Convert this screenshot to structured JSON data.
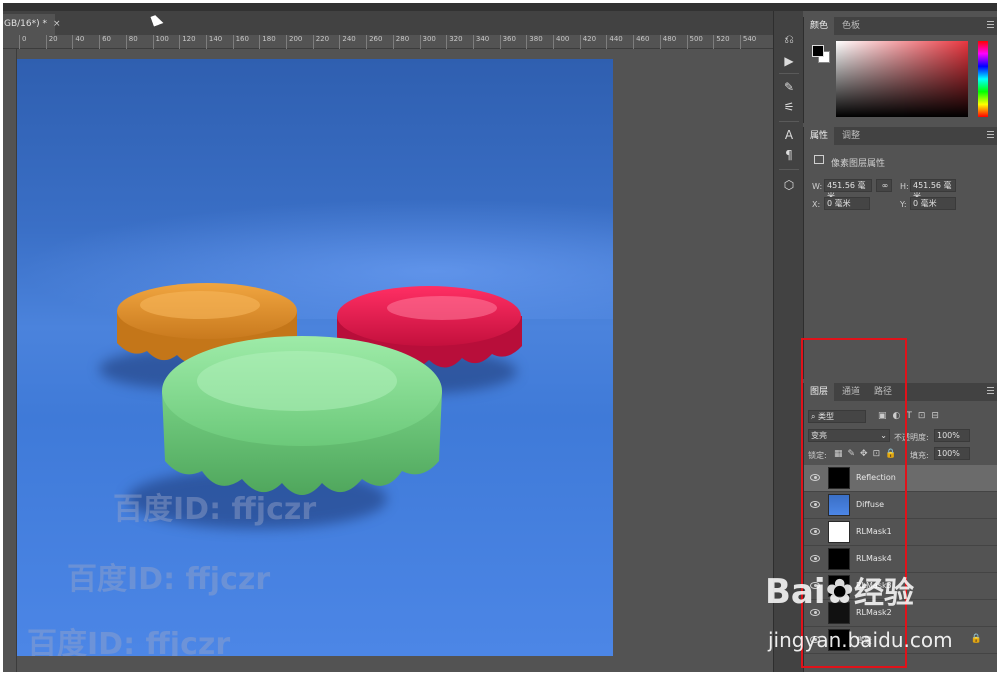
{
  "document_tab": {
    "title": "GB/16*) *",
    "close": "×"
  },
  "ruler_ticks": [
    "0",
    "20",
    "40",
    "60",
    "80",
    "100",
    "120",
    "140",
    "160",
    "180",
    "200",
    "220",
    "240",
    "260",
    "280",
    "300",
    "320",
    "340",
    "360",
    "380",
    "400",
    "420",
    "440",
    "460",
    "480",
    "500",
    "520",
    "540"
  ],
  "canvas_watermarks": [
    "百度ID: ffjczr",
    "百度ID: ffjczr",
    "百度ID: ffjczr"
  ],
  "color_panel": {
    "tabs": [
      "颜色",
      "色板"
    ],
    "foreground": "#000000",
    "background": "#ffffff",
    "hue_color": "#e8363f"
  },
  "properties_panel": {
    "tabs": [
      "属性",
      "调整"
    ],
    "title": "像素图层属性",
    "w_label": "W:",
    "w_value": "451.56 毫米",
    "h_label": "H:",
    "h_value": "451.56 毫米",
    "x_label": "X:",
    "x_value": "0 毫米",
    "y_label": "Y:",
    "y_value": "0 毫米"
  },
  "layers_panel": {
    "tabs": [
      "图层",
      "通道",
      "路径"
    ],
    "filter_label": "类型",
    "blend_mode": "变亮",
    "opacity_label": "不透明度:",
    "opacity_value": "100%",
    "lock_label": "锁定:",
    "fill_label": "填充:",
    "fill_value": "100%",
    "layers": [
      {
        "name": "Reflection",
        "selected": true
      },
      {
        "name": "Diffuse",
        "selected": false
      },
      {
        "name": "RLMask1",
        "selected": false
      },
      {
        "name": "RLMask4",
        "selected": false
      },
      {
        "name": "RLMask3",
        "selected": false
      },
      {
        "name": "RLMask2",
        "selected": false
      },
      {
        "name": "背景",
        "selected": false
      }
    ]
  },
  "baidu_watermark": {
    "logo": "Bai",
    "jingyan": "经验",
    "url": "jingyan.baidu.com"
  },
  "colors": {
    "highlight": "#e0121a",
    "orange_cap": "#e8962e",
    "red_cap": "#e8184f",
    "green_cap": "#8fe09a"
  }
}
